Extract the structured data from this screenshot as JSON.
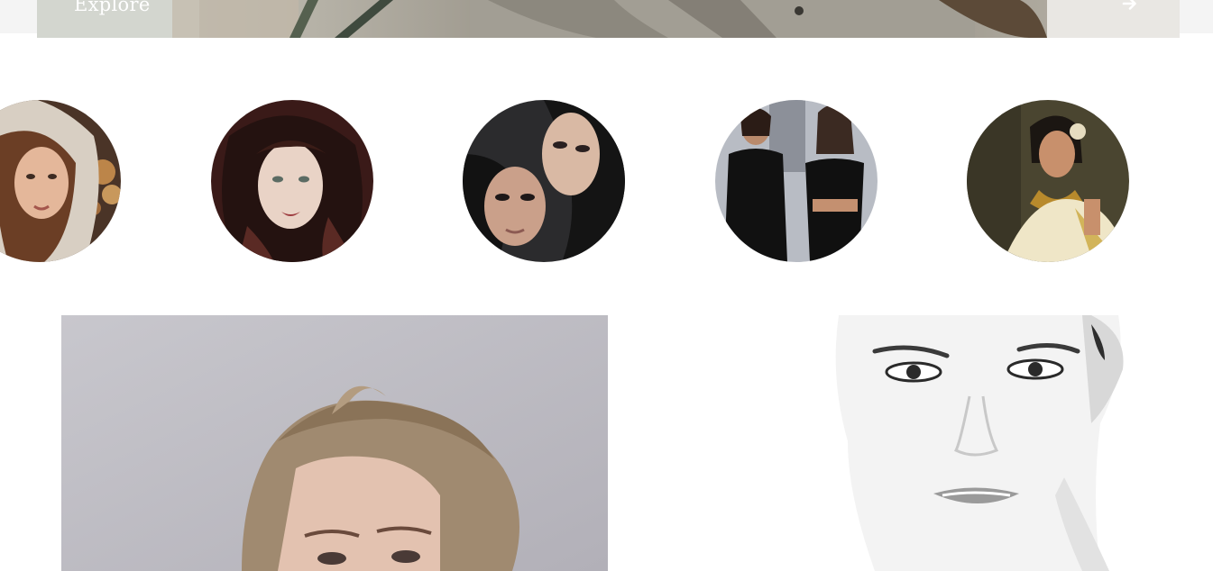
{
  "hero": {
    "label": "Explore",
    "arrow_icon": "arrow-right-icon",
    "text_color": "#ffffff"
  },
  "stories": [
    {
      "name": "hooded-woman-portrait",
      "icon": "avatar"
    },
    {
      "name": "dark-hair-woman-portrait",
      "icon": "avatar"
    },
    {
      "name": "smoky-eyes-duo-portrait",
      "icon": "avatar"
    },
    {
      "name": "two-women-black-outfits",
      "icon": "avatar"
    },
    {
      "name": "bridal-saree-portrait",
      "icon": "avatar"
    }
  ],
  "gallery": {
    "left_photo": "blonde-updo-portrait",
    "right_photo": "monochrome-face-portrait"
  },
  "colors": {
    "page_background": "#ffffff",
    "top_band": "#f4f4f4"
  }
}
